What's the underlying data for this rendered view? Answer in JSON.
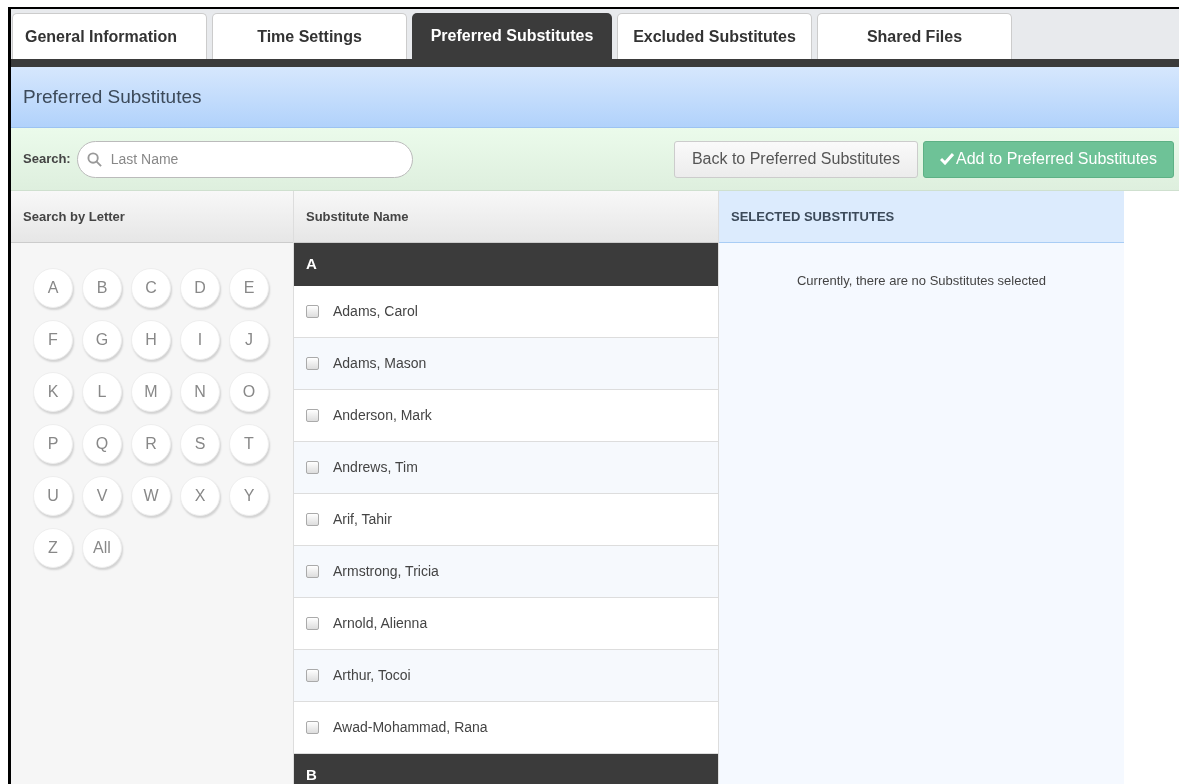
{
  "tabs": [
    {
      "label": "General Information",
      "selected": false
    },
    {
      "label": "Time Settings",
      "selected": false
    },
    {
      "label": "Preferred Substitutes",
      "selected": true
    },
    {
      "label": "Excluded Substitutes",
      "selected": false
    },
    {
      "label": "Shared Files",
      "selected": false
    }
  ],
  "panel_title": "Preferred Substitutes",
  "search": {
    "label": "Search:",
    "placeholder": "Last Name"
  },
  "buttons": [
    {
      "kind": "secondary",
      "label": "Back to Preferred Substitutes"
    },
    {
      "kind": "primary",
      "label": "Add to Preferred Substitutes"
    }
  ],
  "letter_column": {
    "heading": "Search by Letter",
    "letters": [
      "A",
      "B",
      "C",
      "D",
      "E",
      "F",
      "G",
      "H",
      "I",
      "J",
      "K",
      "L",
      "M",
      "N",
      "O",
      "P",
      "Q",
      "R",
      "S",
      "T",
      "U",
      "V",
      "W",
      "X",
      "Y",
      "Z",
      "All"
    ]
  },
  "name_column": {
    "heading": "Substitute Name",
    "groups": [
      {
        "letter": "A",
        "rows": [
          {
            "name": "Adams, Carol",
            "checked": false
          },
          {
            "name": "Adams, Mason",
            "checked": false
          },
          {
            "name": "Anderson, Mark",
            "checked": false
          },
          {
            "name": "Andrews, Tim",
            "checked": false
          },
          {
            "name": "Arif, Tahir",
            "checked": false
          },
          {
            "name": "Armstrong, Tricia",
            "checked": false
          },
          {
            "name": "Arnold, Alienna",
            "checked": false
          },
          {
            "name": "Arthur, Tocoi",
            "checked": false
          },
          {
            "name": "Awad-Mohammad, Rana",
            "checked": false
          }
        ]
      },
      {
        "letter": "B"
      }
    ]
  },
  "selected_column": {
    "heading": "SELECTED SUBSTITUTES",
    "empty_message": "Currently, there are no Substitutes selected"
  }
}
